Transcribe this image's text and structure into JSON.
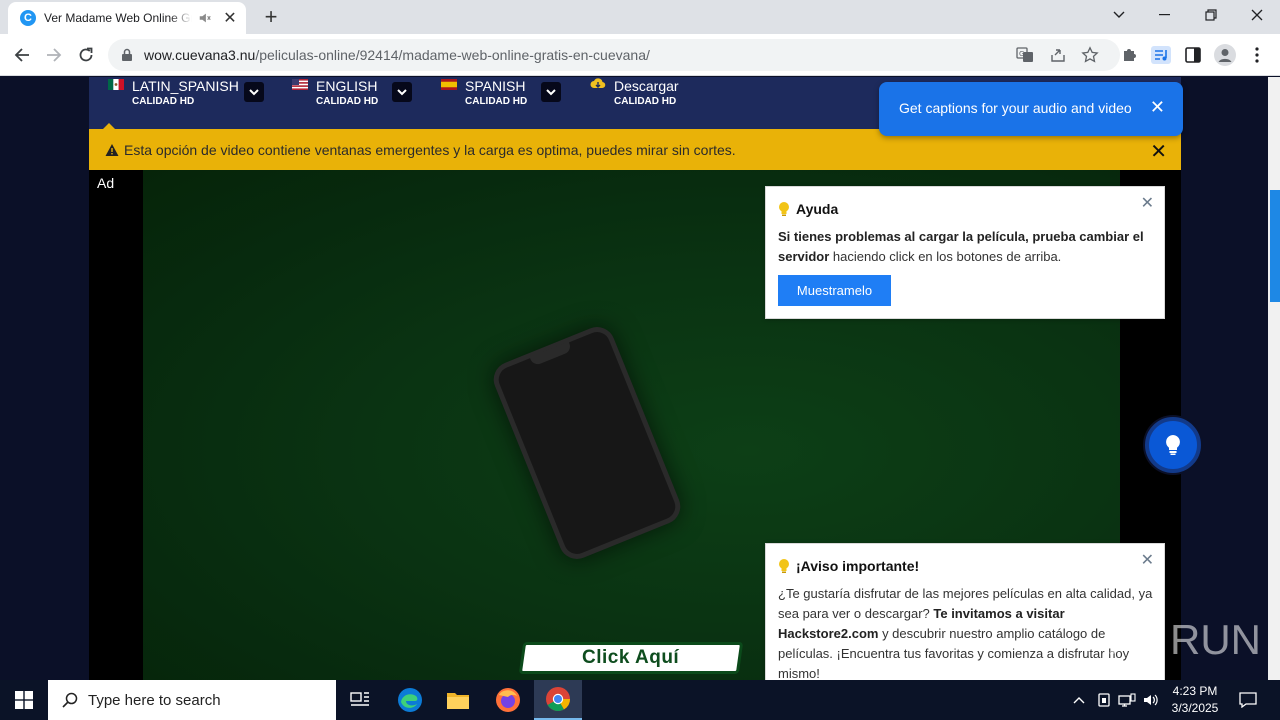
{
  "browser": {
    "tab_title": "Ver Madame Web Online Gratis en Cuevana",
    "favicon_letter": "C",
    "url_host": "wow.cuevana3.nu",
    "url_path": "/peliculas-online/92414/madame-web-online-gratis-en-cuevana/",
    "accent": "#1a73e8"
  },
  "servers": [
    {
      "name": "LATIN_SPANISH",
      "quality": "CALIDAD HD",
      "flag": "mexico-flag-icon"
    },
    {
      "name": "ENGLISH",
      "quality": "CALIDAD HD",
      "flag": "usa-flag-icon"
    },
    {
      "name": "SPANISH",
      "quality": "CALIDAD HD",
      "flag": "spain-flag-icon"
    },
    {
      "name": "Descargar",
      "quality": "CALIDAD HD",
      "flag": "download-cloud-icon"
    }
  ],
  "warning": {
    "text": "Esta opción de video contiene ventanas emergentes y la carga es optima, puedes mirar sin cortes.",
    "close": "✕",
    "color": "#e9b208"
  },
  "player": {
    "ad_label": "Ad",
    "click_button": "Click Aquí"
  },
  "help_card": {
    "title": "Ayuda",
    "body_bold": "Si tienes problemas al cargar la película, prueba cambiar el servidor",
    "body_rest": " haciendo click en los botones de arriba.",
    "button": "Muestramelo",
    "close": "✕"
  },
  "notice_card": {
    "title": "¡Aviso importante!",
    "body_1": "¿Te gustaría disfrutar de las mejores películas en alta calidad, ya sea para ver o descargar? ",
    "body_bold": "Te invitamos a visitar Hackstore2.com",
    "body_2": " y descubrir nuestro amplio catálogo de películas. ¡Encuentra tus favoritas y comienza a disfrutar hoy mismo!",
    "close": "✕"
  },
  "caption_toast": {
    "text": "Get captions for your audio and video",
    "close": "✕"
  },
  "watermark": {
    "text": "RUN"
  },
  "taskbar": {
    "search_placeholder": "Type here to search",
    "time": "4:23 PM",
    "date": "3/3/2025"
  }
}
